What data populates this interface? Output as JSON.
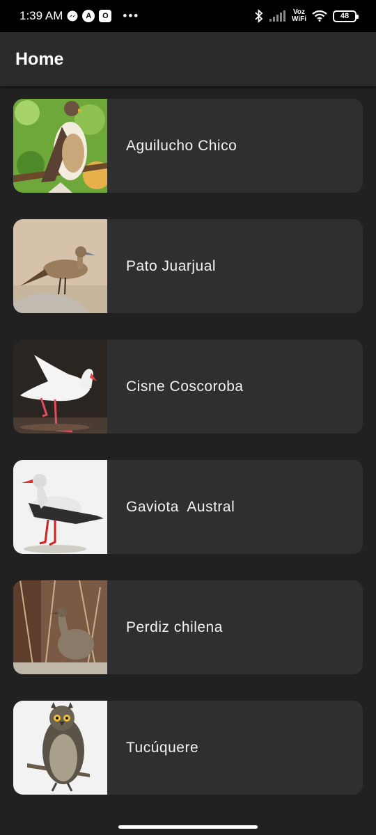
{
  "status_bar": {
    "time": "1:39 AM",
    "messenger_icon": "messenger-icon",
    "app_icon_a": "A",
    "app_icon_b": "O",
    "more": "•••",
    "bluetooth_icon": "bluetooth-icon",
    "signal_icon": "signal-icon",
    "voz_wifi": [
      "Voz",
      "WiFi"
    ],
    "wifi_icon": "wifi-icon",
    "battery": "48"
  },
  "app_bar": {
    "title": "Home"
  },
  "birds": [
    {
      "name": "Aguilucho Chico",
      "image": "hawk-photo"
    },
    {
      "name": "Pato Juarjual",
      "image": "duck-photo"
    },
    {
      "name": "Cisne Coscoroba",
      "image": "swan-photo"
    },
    {
      "name": "Gaviota  Austral",
      "image": "gull-illustration"
    },
    {
      "name": "Perdiz chilena",
      "image": "tinamou-photo"
    },
    {
      "name": "Tucúquere",
      "image": "owl-illustration"
    }
  ],
  "colors": {
    "background": "#212121",
    "app_bar": "#2b2b2b",
    "card": "#2f2f2f",
    "text": "#f2f2f2"
  }
}
